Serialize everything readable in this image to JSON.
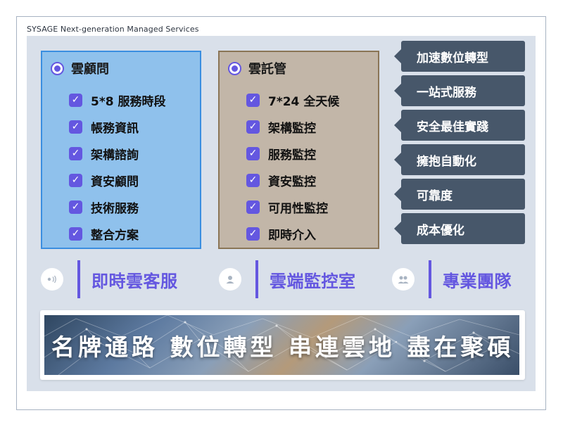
{
  "caption": "SYSAGE Next-generation Managed Services",
  "cards": [
    {
      "title": "雲顧問",
      "items": [
        "5*8 服務時段",
        "帳務資訊",
        "架構諮詢",
        "資安顧問",
        "技術服務",
        "整合方案"
      ]
    },
    {
      "title": "雲託管",
      "items": [
        "7*24 全天候",
        "架構監控",
        "服務監控",
        "資安監控",
        "可用性監控",
        "即時介入"
      ]
    }
  ],
  "tags": [
    "加速數位轉型",
    "一站式服務",
    "安全最佳實踐",
    "擁抱自動化",
    "可靠度",
    "成本優化"
  ],
  "features": [
    {
      "label": "即時雲客服",
      "icon": "support-icon"
    },
    {
      "label": "雲端監控室",
      "icon": "monitor-user-icon"
    },
    {
      "label": "專業團隊",
      "icon": "team-icon"
    }
  ],
  "banner": {
    "text": "名牌通路 數位轉型 串連雲地 盡在聚碩"
  },
  "colors": {
    "accent": "#6457e0",
    "card_blue": "#8fc1ec",
    "card_tan": "#c2b6a8",
    "tag": "#47576a",
    "panel": "#d9e0ea"
  }
}
